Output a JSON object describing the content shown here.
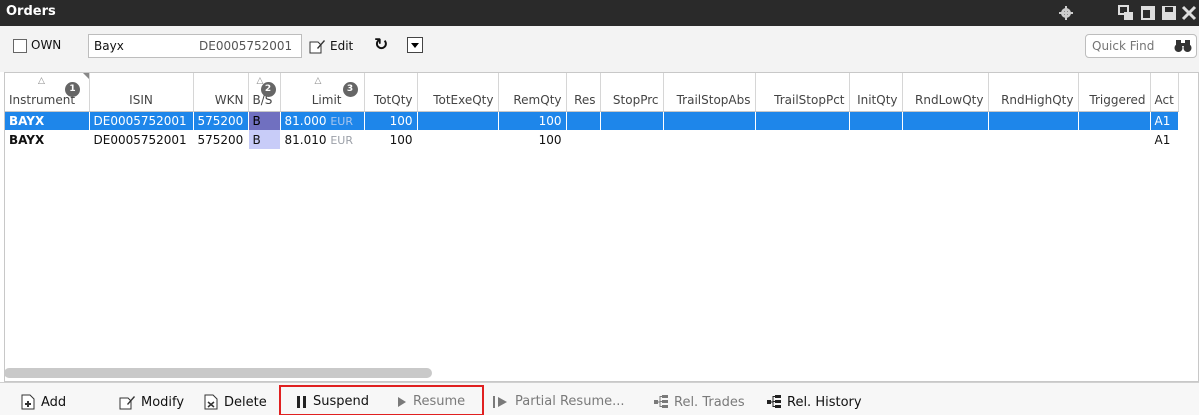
{
  "window": {
    "title": "Orders",
    "icons": [
      "gear-icon",
      "restore-icon",
      "maximize-icon",
      "save-icon",
      "close-icon"
    ]
  },
  "toolbar": {
    "own_label": "OWN",
    "own_checked": false,
    "instrument_name": "Bayx",
    "instrument_isin": "DE0005752001",
    "edit_label": "Edit",
    "quick_find_placeholder": "Quick Find"
  },
  "columns": [
    {
      "label": "Instrument",
      "sort_index": "1"
    },
    {
      "label": "ISIN"
    },
    {
      "label": "WKN"
    },
    {
      "label": "B/S",
      "sort_index": "2"
    },
    {
      "label": "Limit",
      "sort_index": "3"
    },
    {
      "label": "TotQty"
    },
    {
      "label": "TotExeQty"
    },
    {
      "label": "RemQty"
    },
    {
      "label": "Res"
    },
    {
      "label": "StopPrc"
    },
    {
      "label": "TrailStopAbs"
    },
    {
      "label": "TrailStopPct"
    },
    {
      "label": "InitQty"
    },
    {
      "label": "RndLowQty"
    },
    {
      "label": "RndHighQty"
    },
    {
      "label": "Triggered"
    },
    {
      "label": "Act"
    }
  ],
  "rows": [
    {
      "selected": true,
      "cells": [
        "BAYX",
        "DE0005752001",
        "575200",
        "B",
        "81.000",
        "100",
        "",
        "100",
        "",
        "",
        "",
        "",
        "",
        "",
        "",
        "",
        "A1"
      ],
      "currency": "EUR"
    },
    {
      "selected": false,
      "cells": [
        "BAYX",
        "DE0005752001",
        "575200",
        "B",
        "81.010",
        "100",
        "",
        "100",
        "",
        "",
        "",
        "",
        "",
        "",
        "",
        "",
        "A1"
      ],
      "currency": "EUR"
    }
  ],
  "actions": {
    "add": "Add",
    "modify": "Modify",
    "delete": "Delete",
    "suspend": "Suspend",
    "resume": "Resume",
    "partial_resume": "Partial Resume...",
    "rel_trades": "Rel. Trades",
    "rel_history": "Rel. History"
  },
  "colors": {
    "title_bg": "#2a2a2a",
    "selection": "#1e86ea",
    "buy_cell": "#c8ccf8",
    "highlight_box": "#e02020"
  }
}
